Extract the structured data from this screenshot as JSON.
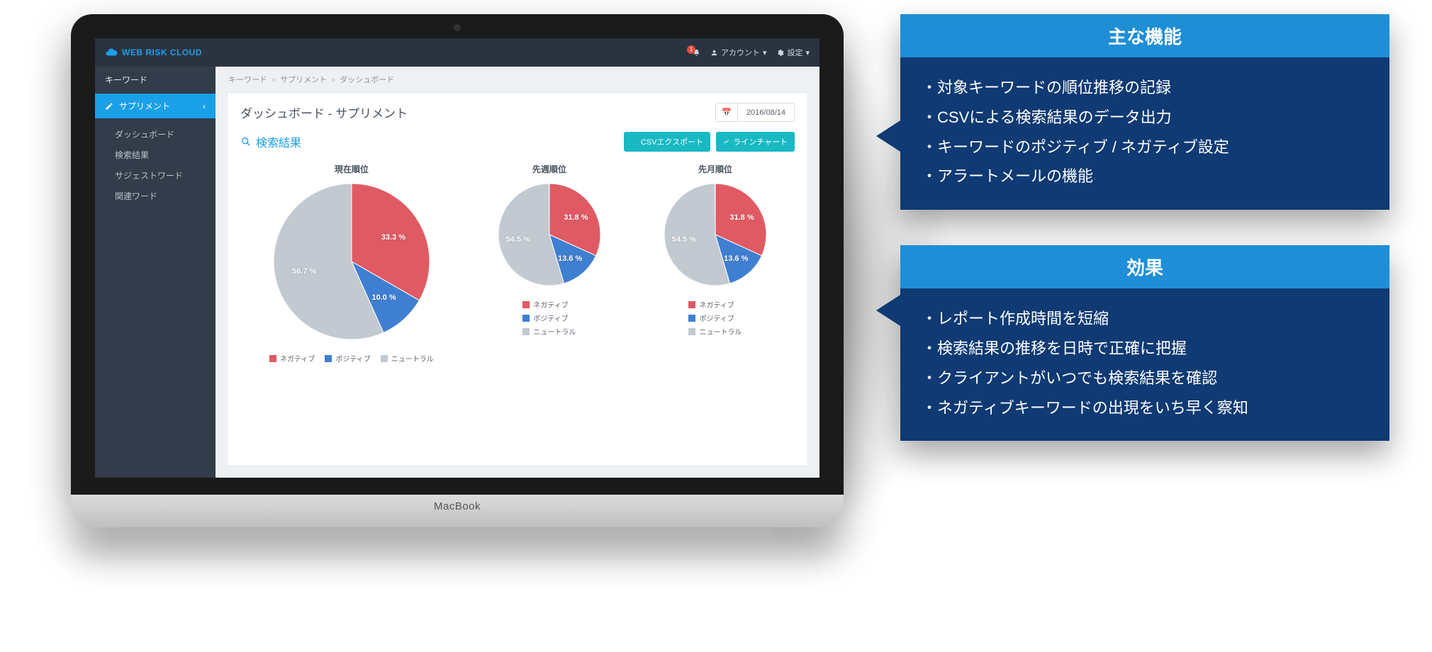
{
  "colors": {
    "negative": "#e05a63",
    "positive": "#3f7fd1",
    "neutral": "#c3c9d1"
  },
  "app": {
    "brand": "WEB RISK CLOUD",
    "notification_count": "1",
    "account_label": "アカウント",
    "settings_label": "設定"
  },
  "sidebar": {
    "heading": "キーワード",
    "active": "サプリメント",
    "items": [
      "ダッシュボード",
      "検索結果",
      "サジェストワード",
      "関連ワード"
    ]
  },
  "crumbs": [
    "キーワード",
    "サプリメント",
    "ダッシュボード"
  ],
  "page": {
    "title": "ダッシュボード - サプリメント",
    "date": "2016/08/14",
    "search_heading": "検索結果",
    "btn_csv": "CSVエクスポート",
    "btn_line": "ラインチャート"
  },
  "legend_labels": {
    "negative": "ネガティブ",
    "positive": "ポジティブ",
    "neutral": "ニュートラル"
  },
  "chart_data": [
    {
      "type": "pie",
      "title": "現在順位",
      "series": [
        {
          "name": "ネガティブ",
          "value": 33.3,
          "label": "33.3 %",
          "color": "#e05a63"
        },
        {
          "name": "ポジティブ",
          "value": 10.0,
          "label": "10.0 %",
          "color": "#3f7fd1"
        },
        {
          "name": "ニュートラル",
          "value": 56.7,
          "label": "56.7 %",
          "color": "#c3c9d1"
        }
      ]
    },
    {
      "type": "pie",
      "title": "先週順位",
      "series": [
        {
          "name": "ネガティブ",
          "value": 31.8,
          "label": "31.8 %",
          "color": "#e05a63"
        },
        {
          "name": "ポジティブ",
          "value": 13.6,
          "label": "13.6 %",
          "color": "#3f7fd1"
        },
        {
          "name": "ニュートラル",
          "value": 54.5,
          "label": "54.5 %",
          "color": "#c3c9d1"
        }
      ]
    },
    {
      "type": "pie",
      "title": "先月順位",
      "series": [
        {
          "name": "ネガティブ",
          "value": 31.8,
          "label": "31.8 %",
          "color": "#e05a63"
        },
        {
          "name": "ポジティブ",
          "value": 13.6,
          "label": "13.6 %",
          "color": "#3f7fd1"
        },
        {
          "name": "ニュートラル",
          "value": 54.5,
          "label": "54.5 %",
          "color": "#c3c9d1"
        }
      ]
    }
  ],
  "cards": {
    "features": {
      "title": "主な機能",
      "items": [
        "対象キーワードの順位推移の記録",
        "CSVによる検索結果のデータ出力",
        "キーワードのポジティブ / ネガティブ設定",
        "アラートメールの機能"
      ]
    },
    "effects": {
      "title": "効果",
      "items": [
        "レポート作成時間を短縮",
        "検索結果の推移を日時で正確に把握",
        "クライアントがいつでも検索結果を確認",
        "ネガティブキーワードの出現をいち早く察知"
      ]
    }
  },
  "laptop_brand": "MacBook"
}
